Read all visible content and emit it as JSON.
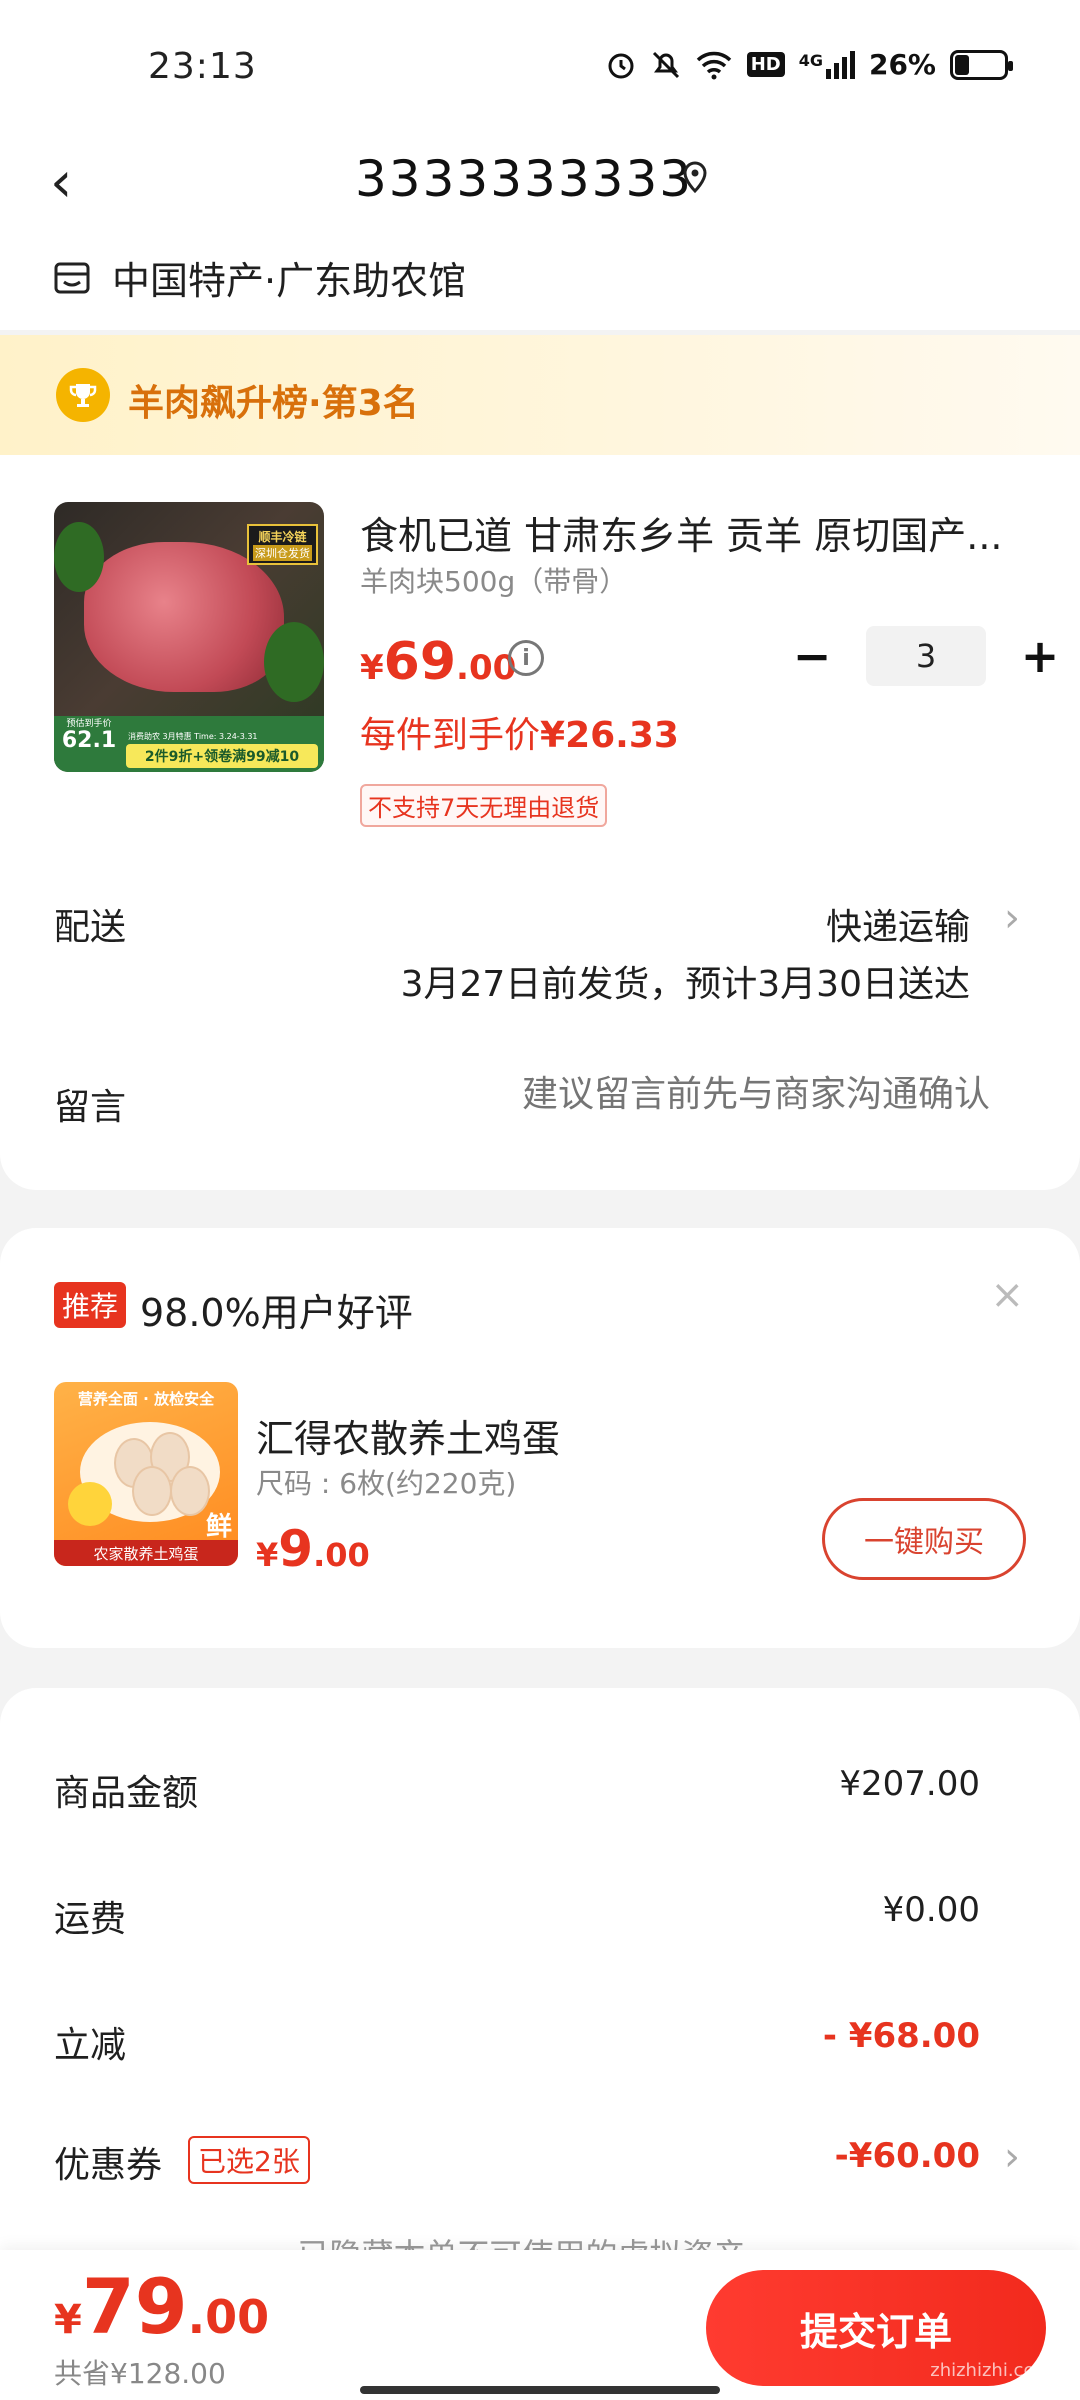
{
  "status_bar": {
    "time": "23:13",
    "network": "4G",
    "hd": "HD",
    "battery_text": "26%",
    "battery_level": 0.26,
    "icons": [
      "alarm-icon",
      "mute-icon",
      "wifi-icon",
      "hd-icon",
      "signal-icon",
      "battery-icon"
    ]
  },
  "header": {
    "back_icon": "chevron-left-icon",
    "phone": "3333333333",
    "location_icon": "location-pin-icon",
    "shop_icon": "store-icon",
    "shop_name": "中国特产·广东助农馆"
  },
  "rank_banner": {
    "icon": "trophy-icon",
    "text": "羊肉飙升榜·第3名"
  },
  "product": {
    "title": "食机已道 甘肃东乡羊 贡羊  原切国产...",
    "spec": "羊肉块500g（带骨）",
    "price_yen": "¥",
    "price_int": "69",
    "price_dec": ".00",
    "per_item_label": "每件到手价",
    "per_item_price": "¥26.33",
    "quantity": "3",
    "minus": "−",
    "plus": "+",
    "return_note": "不支持7天无理由退货",
    "image_badge_top": "顺丰冷链",
    "image_badge_sub": "深圳仓发货",
    "image_price_label": "预估到手价",
    "image_price_value": "62.1",
    "image_promo_top": "消费助农 3月特惠 Time: 3.24-3.31",
    "image_promo": "2件9折+领卷满99减10"
  },
  "delivery": {
    "label": "配送",
    "method": "快递运输",
    "date_note": "3月27日前发货，预计3月30日送达"
  },
  "message": {
    "label": "留言",
    "placeholder": "建议留言前先与商家沟通确认"
  },
  "recommend": {
    "tag": "推荐",
    "rating": "98.0%用户好评",
    "close": "×",
    "title": "汇得农散养土鸡蛋",
    "spec": "尺码 : 6枚(约220克)",
    "price_yen": "¥",
    "price_int": "9",
    "price_dec": ".00",
    "buy_button": "一键购买",
    "image_banner": "营养全面 · 放检安全",
    "image_caption": "农家散养土鸡蛋",
    "image_badge": "鲜"
  },
  "summary": {
    "items": [
      {
        "label": "商品金额",
        "value": "¥207.00"
      },
      {
        "label": "运费",
        "value": "¥0.00"
      },
      {
        "label": "立减",
        "value": "- ¥68.00"
      },
      {
        "label": "优惠券",
        "value": "-¥60.00",
        "tag": "已选2张"
      }
    ],
    "hidden_note": "已隐藏本单不可使用的虚拟资产"
  },
  "bottom": {
    "total_yen": "¥",
    "total_int": "79",
    "total_dec": ".00",
    "saved": "共省¥128.00",
    "submit": "提交订单",
    "watermark": "zhizhizhi.com"
  },
  "colors": {
    "accent": "#e7341f",
    "banner_text": "#d8700b",
    "background": "#f3f3f3"
  }
}
